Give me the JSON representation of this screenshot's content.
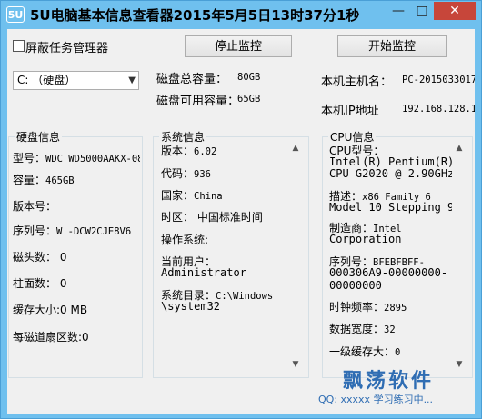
{
  "window": {
    "app_icon_text": "5U",
    "title": "5U电脑基本信息查看器2015年5月5日13时37分1秒",
    "minimize_glyph": "—",
    "maximize_glyph": "□",
    "close_glyph": "✕"
  },
  "toolbar": {
    "hide_task_manager_label": "屏蔽任务管理器",
    "stop_monitor_label": "停止监控",
    "start_monitor_label": "开始监控"
  },
  "disk_select": {
    "value": "C: （硬盘）"
  },
  "disk_summary": {
    "total_label": "磁盘总容量：",
    "total_value": "80GB",
    "free_label": "磁盘可用容量：",
    "free_value": "65GB"
  },
  "host": {
    "hostname_label": "本机主机名：",
    "hostname_value": "PC-2015033017",
    "ip_label": "本机IP地址",
    "ip_value": "192.168.128.1"
  },
  "disk_info": {
    "title": "硬盘信息",
    "model_label": "型号：",
    "model_value": "WDC WD5000AAKX-08",
    "capacity_label": "容量：",
    "capacity_value": "465GB",
    "version_label": "版本号：",
    "serial_label": "序列号：",
    "serial_value": "W -DCW2CJE8V6",
    "heads": "磁头数： 0",
    "cylinders": "柱面数： 0",
    "cache": "缓存大小:0 MB",
    "sectors": "每磁道扇区数:0"
  },
  "system_info": {
    "title": "系统信息",
    "version_label": "版本：",
    "version_value": "6.02",
    "code_label": "代码：",
    "code_value": "936",
    "country_label": "国家：",
    "country_value": "China",
    "timezone": "时区： 中国标准时间",
    "os_label": "操作系统:",
    "user_label": "当前用户：",
    "user_value": "Administrator",
    "sysdir_label": "系统目录：",
    "sysdir_value_1": "C:\\Windows",
    "sysdir_value_2": "\\system32"
  },
  "cpu_info": {
    "title": "CPU信息",
    "type_label": "CPU型号：",
    "type_value_1": "Intel(R) Pentium(R)",
    "type_value_2": "CPU G2020 @ 2.90GHz",
    "desc_label": "描述：",
    "desc_value_1": "x86 Family 6",
    "desc_value_2": "Model 10 Stepping 9",
    "maker_label": "制造商：",
    "maker_value_1": "Intel",
    "maker_value_2": "Corporation",
    "serial_label": "序列号：",
    "serial_value_1": "BFEBFBFF-",
    "serial_value_2": "000306A9-00000000-",
    "serial_value_3": "00000000",
    "clock_label": "时钟频率：",
    "clock_value": "2895",
    "width_label": "数据宽度：",
    "width_value": "32",
    "l1_label": "一级缓存大：",
    "l1_value": "0"
  },
  "footer": {
    "brand": "飘荡软件",
    "qq": "QQ: xxxxx  学习练习中..."
  }
}
